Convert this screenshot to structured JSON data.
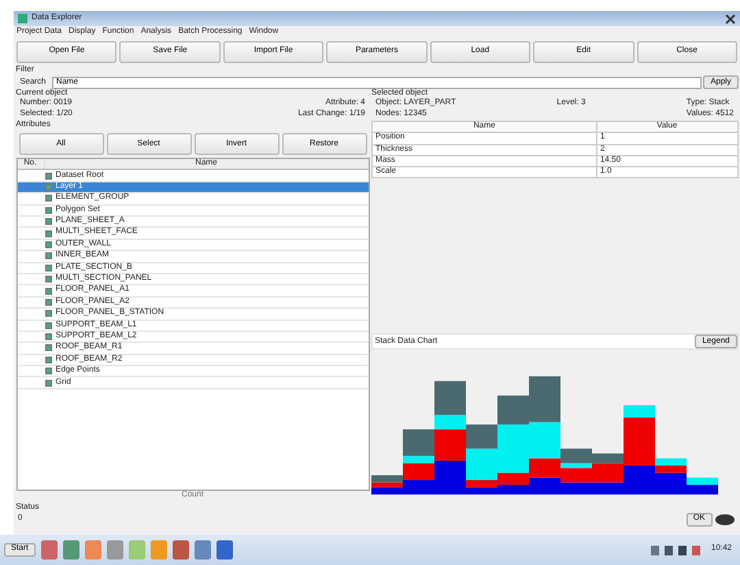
{
  "window": {
    "title": "Data Explorer"
  },
  "menu": [
    "Project Data",
    "Display",
    "Function",
    "Analysis",
    "Batch Processing",
    "Window"
  ],
  "toolbar": [
    "Open File",
    "Save File",
    "Import File",
    "Parameters",
    "Load",
    "Edit",
    "Close"
  ],
  "filter": {
    "label": "Filter",
    "search_label": "Search",
    "value": "Name",
    "button": "Apply"
  },
  "current_object": {
    "title": "Current object",
    "left": [
      "Number: 0019",
      "Selected: 1/20"
    ],
    "right": [
      "Attribute: 4",
      "Last Change: 1/19"
    ]
  },
  "attributes": {
    "title": "Attributes",
    "buttons": [
      "All",
      "Select",
      "Invert",
      "Restore"
    ]
  },
  "object_list": {
    "columns": [
      "No.",
      "Name"
    ],
    "rows": [
      {
        "name": "Dataset Root",
        "checked": true,
        "selected": false
      },
      {
        "name": "Layer 1",
        "checked": true,
        "selected": true
      },
      {
        "name": "ELEMENT_GROUP",
        "checked": true,
        "selected": false
      },
      {
        "name": "Polygon Set",
        "checked": true,
        "selected": false
      },
      {
        "name": "PLANE_SHEET_A",
        "checked": true,
        "selected": false
      },
      {
        "name": "MULTI_SHEET_FACE",
        "checked": true,
        "selected": false
      },
      {
        "name": "OUTER_WALL",
        "checked": true,
        "selected": false
      },
      {
        "name": "INNER_BEAM",
        "checked": true,
        "selected": false
      },
      {
        "name": "PLATE_SECTION_B",
        "checked": true,
        "selected": false
      },
      {
        "name": "MULTI_SECTION_PANEL",
        "checked": true,
        "selected": false
      },
      {
        "name": "FLOOR_PANEL_A1",
        "checked": true,
        "selected": false
      },
      {
        "name": "FLOOR_PANEL_A2",
        "checked": true,
        "selected": false
      },
      {
        "name": "FLOOR_PANEL_B_STATION",
        "checked": true,
        "selected": false
      },
      {
        "name": "SUPPORT_BEAM_L1",
        "checked": true,
        "selected": false
      },
      {
        "name": "SUPPORT_BEAM_L2",
        "checked": true,
        "selected": false
      },
      {
        "name": "ROOF_BEAM_R1",
        "checked": true,
        "selected": false
      },
      {
        "name": "ROOF_BEAM_R2",
        "checked": true,
        "selected": false
      },
      {
        "name": "Edge Points",
        "checked": true,
        "selected": false
      },
      {
        "name": "Grid",
        "checked": true,
        "selected": false
      }
    ],
    "footer": "Count"
  },
  "selected_object": {
    "title": "Selected object",
    "left": [
      "Object: LAYER_PART",
      "Nodes: 12345"
    ],
    "middle": [
      "Level: 3"
    ],
    "right": [
      "Type: Stack",
      "Values: 4512"
    ]
  },
  "properties": {
    "columns": [
      "Name",
      "Value"
    ],
    "rows": [
      [
        "Position",
        "1"
      ],
      [
        "Thickness",
        "2"
      ],
      [
        "Mass",
        "14.50"
      ],
      [
        "Scale",
        "1.0"
      ]
    ]
  },
  "chart": {
    "title": "Stack Data Chart",
    "button": "Legend"
  },
  "status": {
    "label": "Status",
    "text": "0",
    "button": "OK"
  },
  "taskbar": {
    "start": "Start",
    "clock": "10:42"
  }
}
